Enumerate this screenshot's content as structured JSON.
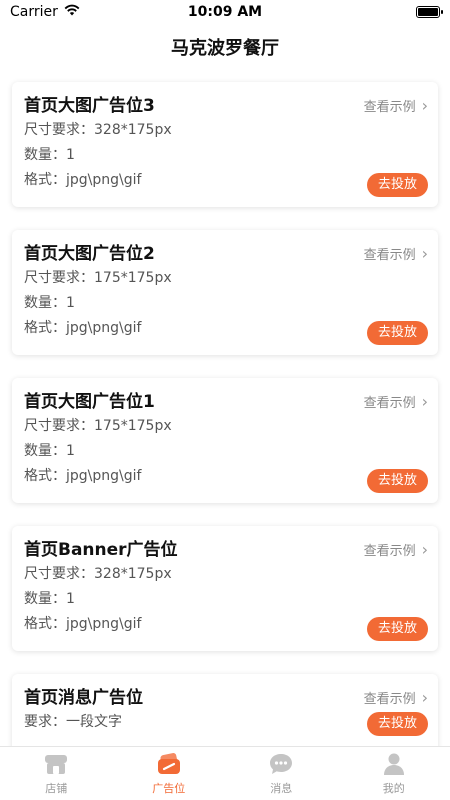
{
  "status_bar": {
    "carrier": "Carrier",
    "time": "10:09 AM"
  },
  "header": {
    "title": "马克波罗餐厅"
  },
  "cards": [
    {
      "title": "首页大图广告位3",
      "example_label": "查看示例",
      "lines": [
        "尺寸要求：328*175px",
        "数量：1",
        "格式：jpg\\png\\gif"
      ],
      "button": "去投放"
    },
    {
      "title": "首页大图广告位2",
      "example_label": "查看示例",
      "lines": [
        "尺寸要求：175*175px",
        "数量：1",
        "格式：jpg\\png\\gif"
      ],
      "button": "去投放"
    },
    {
      "title": "首页大图广告位1",
      "example_label": "查看示例",
      "lines": [
        "尺寸要求：175*175px",
        "数量：1",
        "格式：jpg\\png\\gif"
      ],
      "button": "去投放"
    },
    {
      "title": "首页Banner广告位",
      "example_label": "查看示例",
      "lines": [
        "尺寸要求：328*175px",
        "数量：1",
        "格式：jpg\\png\\gif"
      ],
      "button": "去投放"
    },
    {
      "title": "首页消息广告位",
      "example_label": "查看示例",
      "lines": [
        "要求：一段文字"
      ],
      "button": "去投放"
    }
  ],
  "tabbar": {
    "items": [
      {
        "label": "店铺",
        "icon": "store-icon",
        "active": false
      },
      {
        "label": "广告位",
        "icon": "ad-icon",
        "active": true
      },
      {
        "label": "消息",
        "icon": "message-icon",
        "active": false
      },
      {
        "label": "我的",
        "icon": "profile-icon",
        "active": false
      }
    ]
  },
  "colors": {
    "accent": "#f26a35",
    "inactive": "#b0b0b0",
    "text": "#1a1a1a",
    "secondary": "#555555"
  }
}
